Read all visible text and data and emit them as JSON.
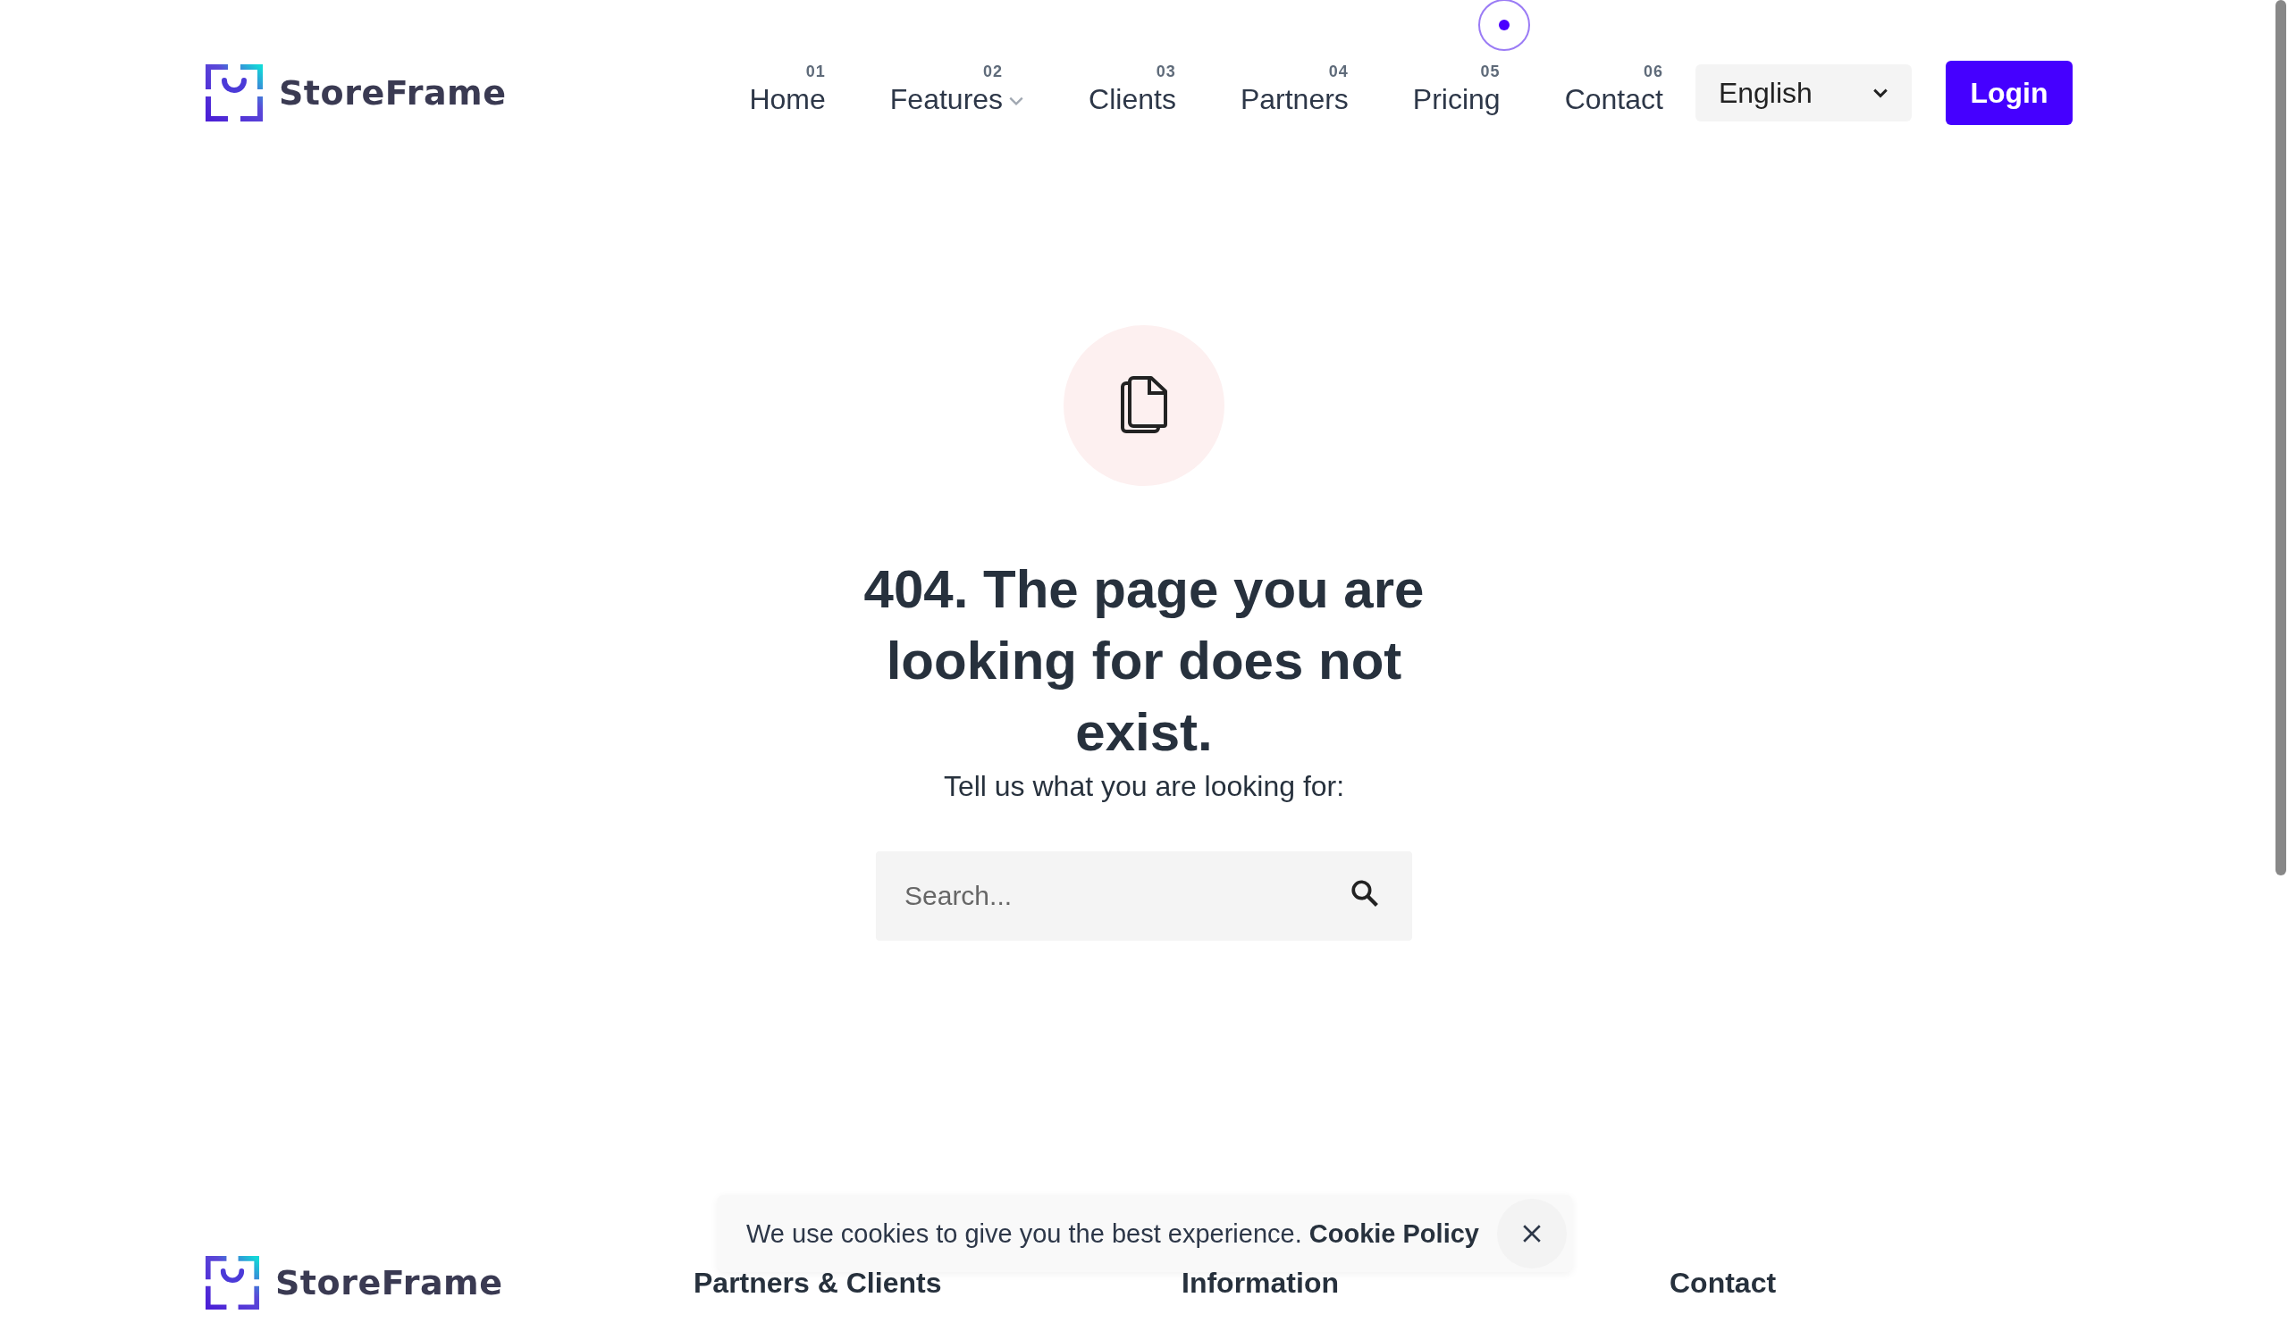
{
  "header": {
    "logo_text": "StoreFrame",
    "nav": [
      {
        "number": "01",
        "label": "Home",
        "dropdown": false
      },
      {
        "number": "02",
        "label": "Features",
        "dropdown": true
      },
      {
        "number": "03",
        "label": "Clients",
        "dropdown": false
      },
      {
        "number": "04",
        "label": "Partners",
        "dropdown": false
      },
      {
        "number": "05",
        "label": "Pricing",
        "dropdown": false
      },
      {
        "number": "06",
        "label": "Contact",
        "dropdown": false
      }
    ],
    "language": "English",
    "login": "Login"
  },
  "error": {
    "title": "404. The page you are looking for does not exist.",
    "subtitle": "Tell us what you are looking for:",
    "search": {
      "placeholder": "Search..."
    }
  },
  "footer": {
    "logo_text": "StoreFrame",
    "columns": [
      "Partners & Clients",
      "Information",
      "Contact"
    ]
  },
  "cookie_banner": {
    "text": "We use cookies to give you the best experience.",
    "link": "Cookie Policy"
  }
}
